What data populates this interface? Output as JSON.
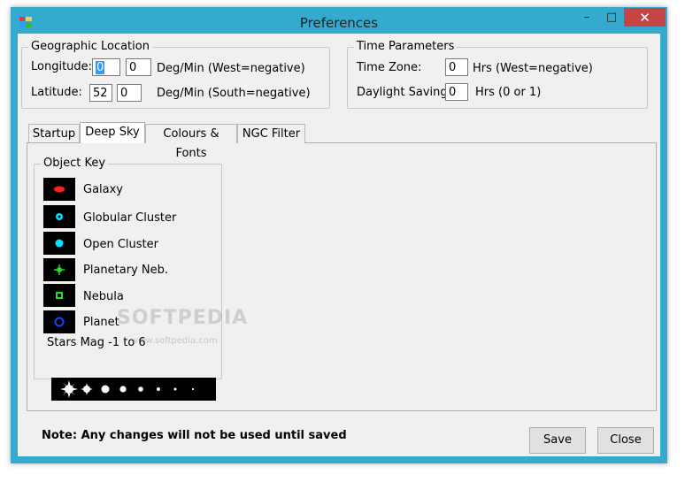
{
  "window": {
    "title": "Preferences",
    "close_glyph": "✕",
    "minimize_glyph": "–",
    "maximize_glyph": "□"
  },
  "geographic": {
    "legend": "Geographic Location",
    "longitude": {
      "label": "Longitude:",
      "deg": "0",
      "min": "0",
      "units": "Deg/Min (West=negative)"
    },
    "latitude": {
      "label": "Latitude:",
      "deg": "52",
      "min": "0",
      "units": "Deg/Min (South=negative)"
    }
  },
  "time": {
    "legend": "Time Parameters",
    "zone": {
      "label": "Time Zone:",
      "value": "0",
      "units": "Hrs (West=negative)"
    },
    "dst": {
      "label": "Daylight Saving:",
      "value": "0",
      "units": "Hrs (0 or 1)"
    }
  },
  "tabs": [
    {
      "label": "Startup",
      "active": false
    },
    {
      "label": "Deep Sky",
      "active": true
    },
    {
      "label": "Colours & Fonts",
      "active": false
    },
    {
      "label": "NGC Filter",
      "active": false
    }
  ],
  "object_key": {
    "legend": "Object Key",
    "items": [
      {
        "label": "Galaxy",
        "icon": "galaxy-icon",
        "color": "#ff2020"
      },
      {
        "label": "Globular Cluster",
        "icon": "globular-cluster-icon",
        "color": "#00e5ff"
      },
      {
        "label": "Open Cluster",
        "icon": "open-cluster-icon",
        "color": "#00e5ff"
      },
      {
        "label": "Planetary Neb.",
        "icon": "planetary-nebula-icon",
        "color": "#20e020"
      },
      {
        "label": "Nebula",
        "icon": "nebula-icon",
        "color": "#20e020"
      },
      {
        "label": "Planet",
        "icon": "planet-icon",
        "color": "#2040ff"
      }
    ],
    "stars_label": "Stars Mag -1 to 6"
  },
  "watermark": {
    "text": "SOFTPEDIA",
    "url": "www.softpedia.com"
  },
  "note": "Note: Any changes will not be used until saved",
  "buttons": {
    "save": "Save",
    "close": "Close"
  },
  "colors": {
    "titlebar": "#34abce",
    "close_button": "#c74444",
    "selection": "#3399ff"
  }
}
